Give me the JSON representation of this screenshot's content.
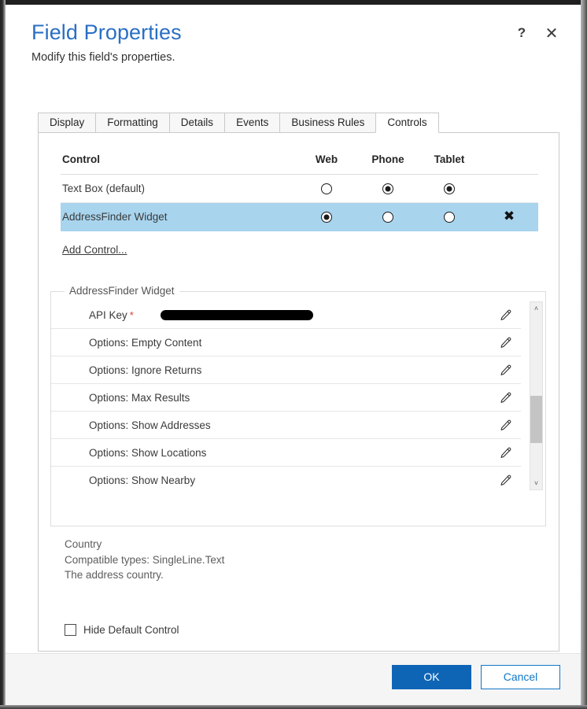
{
  "header": {
    "title": "Field Properties",
    "subtitle": "Modify this field's properties.",
    "help_icon": "question-mark-icon",
    "close_icon": "close-icon"
  },
  "tabs": [
    {
      "label": "Display",
      "active": false
    },
    {
      "label": "Formatting",
      "active": false
    },
    {
      "label": "Details",
      "active": false
    },
    {
      "label": "Events",
      "active": false
    },
    {
      "label": "Business Rules",
      "active": false
    },
    {
      "label": "Controls",
      "active": true
    }
  ],
  "controls_table": {
    "headers": {
      "control": "Control",
      "web": "Web",
      "phone": "Phone",
      "tablet": "Tablet"
    },
    "rows": [
      {
        "name": "Text Box (default)",
        "web": false,
        "phone": true,
        "tablet": true,
        "removable": false,
        "selected": false,
        "remove_label": ""
      },
      {
        "name": "AddressFinder Widget",
        "web": true,
        "phone": false,
        "tablet": false,
        "removable": true,
        "selected": true,
        "remove_label": "✖"
      }
    ],
    "add_control_label": "Add Control..."
  },
  "properties": {
    "legend": "AddressFinder Widget",
    "rows": [
      {
        "label": "API Key",
        "required": true,
        "value_redacted": true
      },
      {
        "label": "Options: Empty Content",
        "required": false,
        "value_redacted": false
      },
      {
        "label": "Options: Ignore Returns",
        "required": false,
        "value_redacted": false
      },
      {
        "label": "Options: Max Results",
        "required": false,
        "value_redacted": false
      },
      {
        "label": "Options: Show Addresses",
        "required": false,
        "value_redacted": false
      },
      {
        "label": "Options: Show Locations",
        "required": false,
        "value_redacted": false
      },
      {
        "label": "Options: Show Nearby",
        "required": false,
        "value_redacted": false
      }
    ],
    "required_marker": "*",
    "edit_icon": "pencil-icon",
    "scrollbar": {
      "up_arrow": "˄",
      "down_arrow": "˅"
    }
  },
  "description": {
    "line1": "Country",
    "line2": "Compatible types: SingleLine.Text",
    "line3": "The address country."
  },
  "hide_default": {
    "label": "Hide Default Control",
    "checked": false
  },
  "footer": {
    "ok_label": "OK",
    "cancel_label": "Cancel"
  },
  "colors": {
    "title_blue": "#2a6fc4",
    "selected_row": "#a8d4ee",
    "primary_button": "#0f65b5",
    "secondary_button_text": "#1277c8",
    "required_star": "#e13a2b"
  }
}
